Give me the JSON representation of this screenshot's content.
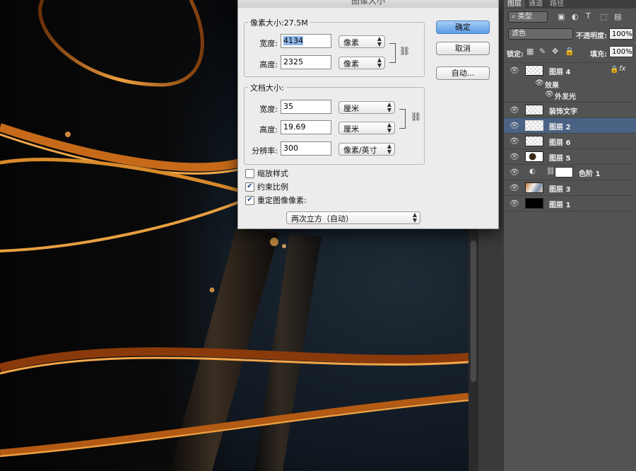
{
  "dialog": {
    "title": "图像大小",
    "pixel_group_title": "像素大小:27.5M",
    "width_label": "宽度:",
    "width_value": "4134",
    "width_unit": "像素",
    "height_label": "高度:",
    "height_value": "2325",
    "height_unit": "像素",
    "doc_group_title": "文档大小:",
    "doc_width_label": "宽度:",
    "doc_width_value": "35",
    "doc_width_unit": "厘米",
    "doc_height_label": "高度:",
    "doc_height_value": "19.69",
    "doc_height_unit": "厘米",
    "resolution_label": "分辨率:",
    "resolution_value": "300",
    "resolution_unit": "像素/英寸",
    "scale_styles_label": "缩放样式",
    "scale_styles_checked": false,
    "constrain_label": "约束比例",
    "constrain_checked": true,
    "resample_label": "重定图像像素:",
    "resample_checked": true,
    "resample_method": "两次立方（自动）",
    "ok_label": "确定",
    "cancel_label": "取消",
    "auto_label": "自动..."
  },
  "panel": {
    "tabs": [
      "图层",
      "通道",
      "路径"
    ],
    "filter_kind": "类型",
    "blend_mode": "滤色",
    "opacity_label": "不透明度:",
    "opacity_value": "100%",
    "lock_label": "锁定:",
    "fill_label": "填充:",
    "fill_value": "100%",
    "layers": [
      {
        "name": "图层 4",
        "thumb": "transparent",
        "fx": "fx"
      },
      {
        "name": "效果",
        "sub": true
      },
      {
        "name": "外发光",
        "sub": true
      },
      {
        "name": "装饰文字",
        "thumb": "transparent"
      },
      {
        "name": "图层 2",
        "thumb": "transparent",
        "selected": true
      },
      {
        "name": "图层 6",
        "thumb": "transparent"
      },
      {
        "name": "图层 5",
        "thumb": "ring"
      },
      {
        "name": "色阶 1",
        "thumb": "white",
        "adjustment": true
      },
      {
        "name": "图层 3",
        "thumb": "photo"
      },
      {
        "name": "图层 1",
        "thumb": "black"
      }
    ]
  },
  "colors": {
    "gold": "#e79a3a",
    "selection": "#4a6283",
    "primary_button": "#5a9be6"
  }
}
